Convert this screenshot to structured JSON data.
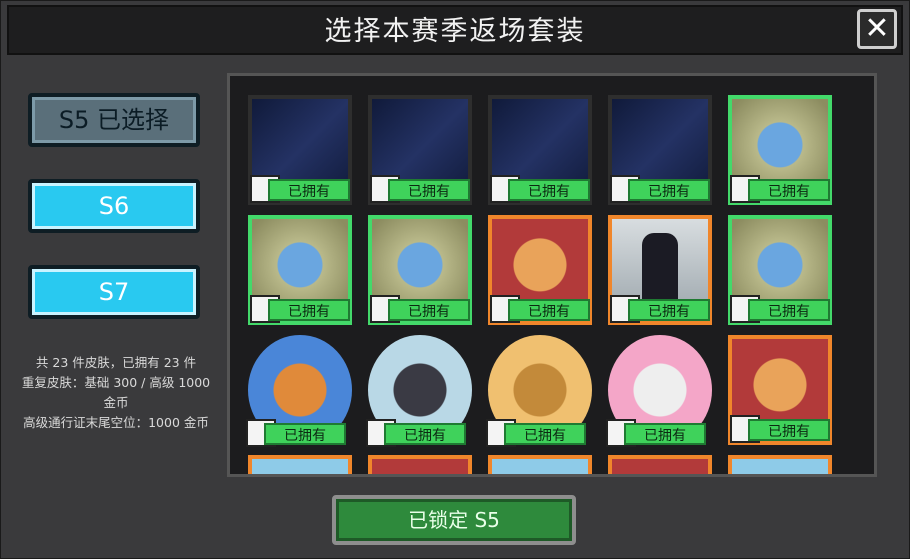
{
  "title": "选择本赛季返场套装",
  "close_icon": "close-icon",
  "seasons": [
    {
      "label": "S5  已选择",
      "state": "selected"
    },
    {
      "label": "S6",
      "state": "available"
    },
    {
      "label": "S7",
      "state": "available"
    }
  ],
  "info": {
    "line1": "共 23 件皮肤，已拥有 23 件",
    "line2": "重复皮肤：基础 300 / 高级 1000 金币",
    "line3": "高级通行证末尾空位：1000 金币"
  },
  "owned_label": "已拥有",
  "lock_button": "已锁定 S5",
  "colors": {
    "owned_badge": "#3fd25b",
    "selected_season": "#5a6f7a",
    "available_season": "#29c9f0",
    "rare_border": "#43d96a",
    "epic_border": "#f0862b"
  }
}
